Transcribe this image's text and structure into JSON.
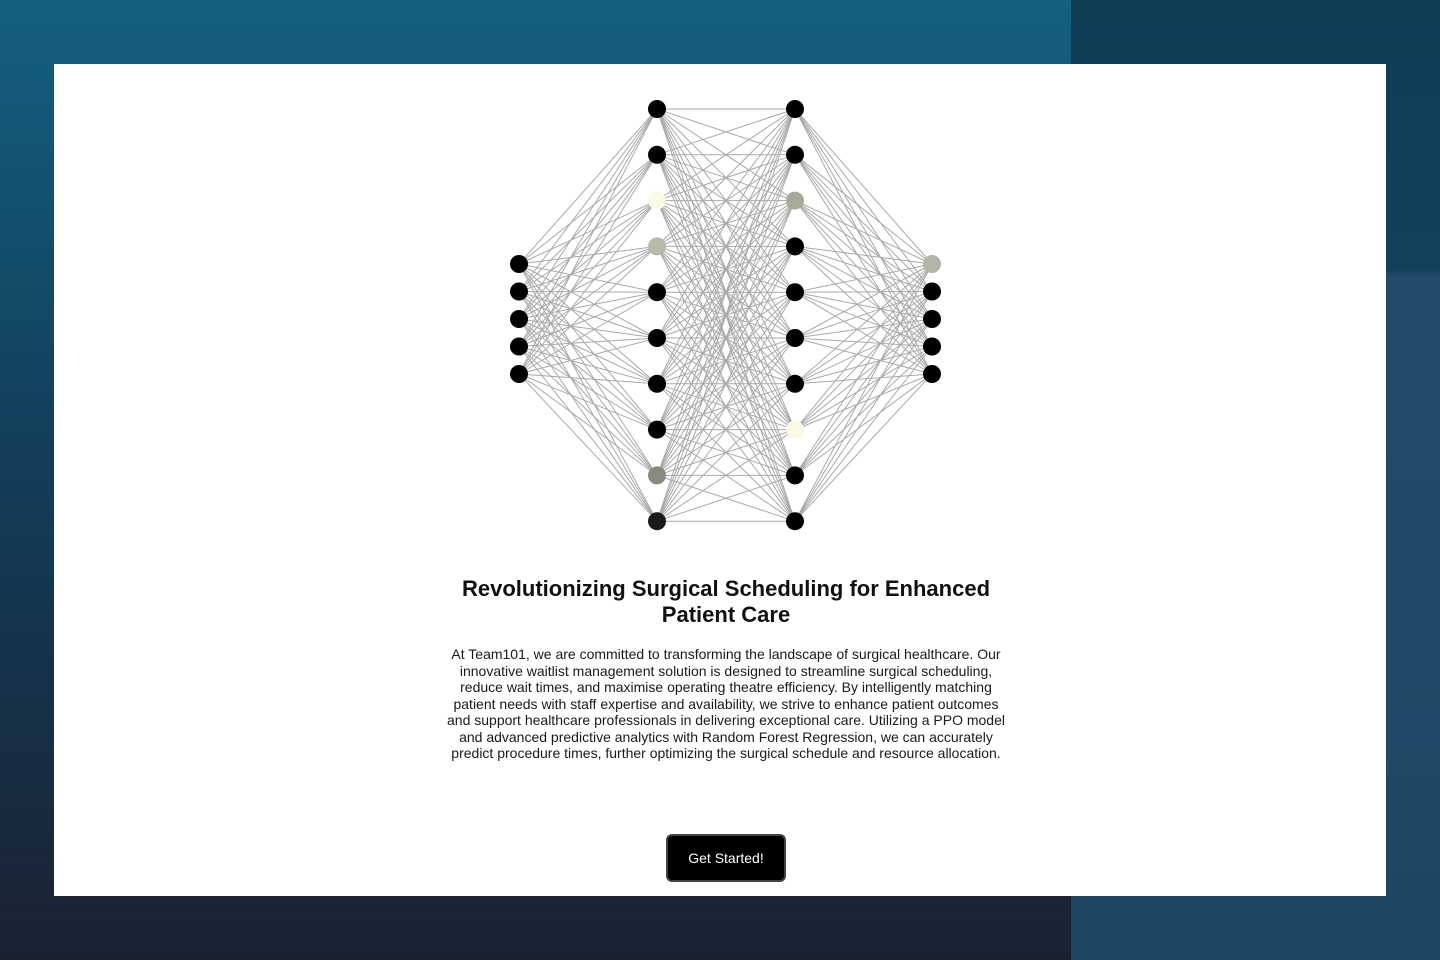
{
  "hero": {
    "headline": "Revolutionizing Surgical Scheduling for Enhanced Patient Care",
    "description": "At Team101, we are committed to transforming the landscape of surgical healthcare. Our innovative waitlist management solution is designed to streamline surgical scheduling, reduce wait times, and maximise operating theatre efficiency. By intelligently matching patient needs with staff expertise and availability, we strive to enhance patient outcomes and support healthcare professionals in delivering exceptional care. Utilizing a PPO model and advanced predictive analytics with Random Forest Regression, we can accurately predict procedure times, further optimizing the surgical schedule and resource allocation.",
    "cta_label": "Get Started!"
  },
  "network": {
    "edge_color": "#a9a9a9",
    "layers": [
      [
        "#000000",
        "#000000",
        "#000000",
        "#000000",
        "#000000"
      ],
      [
        "#000000",
        "#000000",
        "#fafae6",
        "#b9b9a9",
        "#000000",
        "#000000",
        "#000000",
        "#000000",
        "#8a8a80",
        "#1a1a1a"
      ],
      [
        "#000000",
        "#000000",
        "#a9a99b",
        "#000000",
        "#000000",
        "#000000",
        "#000000",
        "#fafae6",
        "#000000",
        "#000000"
      ],
      [
        "#b4b4a8",
        "#000000",
        "#000000",
        "#000000",
        "#000000"
      ]
    ]
  }
}
